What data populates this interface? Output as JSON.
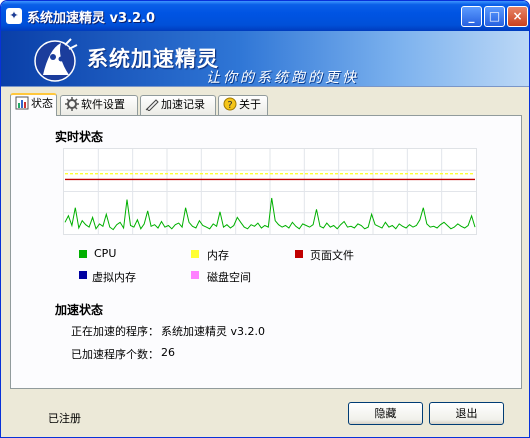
{
  "window": {
    "title": "系统加速精灵 v3.2.0",
    "icon": "ghost-app-icon",
    "controls": {
      "minimize": "_",
      "maximize": "□",
      "close": "×"
    }
  },
  "banner": {
    "title": "系统加速精灵",
    "subtitle": "让你的系统跑的更快",
    "logo": "wizard-logo"
  },
  "tabs": [
    {
      "label": "状态",
      "icon": "status-icon",
      "active": true
    },
    {
      "label": "软件设置",
      "icon": "settings-icon",
      "active": false
    },
    {
      "label": "加速记录",
      "icon": "log-icon",
      "active": false
    },
    {
      "label": "关于",
      "icon": "about-icon",
      "active": false
    }
  ],
  "realtime": {
    "title": "实时状态"
  },
  "legend": [
    {
      "label": "CPU",
      "color": "#00b000"
    },
    {
      "label": "内存",
      "color": "#ffff33"
    },
    {
      "label": "页面文件",
      "color": "#c00000"
    },
    {
      "label": "虚拟内存",
      "color": "#0000a0"
    },
    {
      "label": "磁盘空间",
      "color": "#ff80ff"
    }
  ],
  "acceleration": {
    "title": "加速状态",
    "program_label": "正在加速的程序：",
    "program_value": "系统加速精灵 v3.2.0",
    "count_label": "已加速程序个数：",
    "count_value": "26"
  },
  "footer": {
    "registered": "已注册",
    "hide_button": "隐藏",
    "exit_button": "退出"
  },
  "chart_data": {
    "type": "line",
    "ylim": [
      0,
      100
    ],
    "grid": true,
    "series": [
      {
        "name": "CPU",
        "color": "#00b000",
        "values": [
          12,
          20,
          8,
          30,
          5,
          14,
          9,
          6,
          18,
          4,
          10,
          7,
          22,
          6,
          3,
          9,
          12,
          5,
          40,
          8,
          6,
          15,
          4,
          10,
          26,
          7,
          9,
          5,
          13,
          6,
          8,
          4,
          9,
          11,
          6,
          30,
          12,
          7,
          5,
          14,
          8,
          6,
          4,
          10,
          7,
          25,
          6,
          9,
          5,
          8,
          18,
          12,
          6,
          4,
          9,
          7,
          11,
          5,
          8,
          6,
          42,
          14,
          9,
          6,
          8,
          5,
          12,
          7,
          4,
          10,
          8,
          6,
          9,
          28,
          7,
          5,
          11,
          6,
          8,
          4,
          9,
          13,
          6,
          7,
          5,
          10,
          8,
          4,
          6,
          22,
          9,
          7,
          5,
          12,
          6,
          8,
          4,
          10,
          7,
          5,
          9,
          6,
          8,
          15,
          30,
          10,
          6,
          7,
          5,
          9,
          12,
          8,
          4,
          6,
          10,
          7,
          5,
          8,
          20,
          6
        ]
      },
      {
        "name": "页面文件",
        "color": "#c00000",
        "values": [
          65,
          65,
          65,
          65,
          65,
          65,
          65,
          65,
          65,
          65,
          65,
          65
        ]
      },
      {
        "name": "内存",
        "color": "#ffff33",
        "values": [
          72,
          72,
          72,
          72,
          72,
          72,
          72,
          72,
          72,
          72,
          72,
          72
        ]
      }
    ]
  }
}
